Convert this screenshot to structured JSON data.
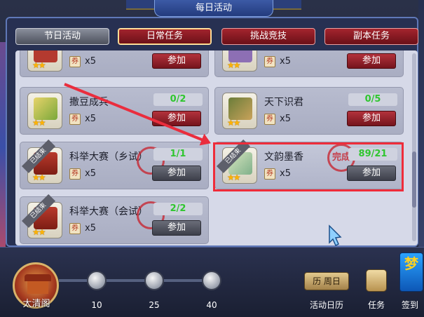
{
  "header": {
    "title": "每日活动"
  },
  "tabs": [
    {
      "label": "节日活动",
      "style": "gray"
    },
    {
      "label": "日常任务",
      "style": "red",
      "active": true
    },
    {
      "label": "挑战竞技",
      "style": "red"
    },
    {
      "label": "副本任务",
      "style": "red"
    }
  ],
  "tasks": [
    {
      "name": "",
      "count": "x5",
      "button": "参加",
      "stars": "★★"
    },
    {
      "name": "",
      "count": "x5",
      "button": "参加",
      "stars": "★★"
    },
    {
      "name": "撒豆成兵",
      "progress": "0/2",
      "count": "x5",
      "button": "参加",
      "stars": "★★"
    },
    {
      "name": "天下识君",
      "progress": "0/5",
      "count": "x5",
      "button": "参加",
      "stars": "★★"
    },
    {
      "name": "科举大赛（乡试）",
      "progress": "1/1",
      "count": "x5",
      "button": "参加",
      "stars": "★★",
      "badge": "已结束"
    },
    {
      "name": "文韵墨香",
      "progress": "89/21",
      "count": "x5",
      "button": "参加",
      "stars": "★★",
      "badge": "已结束",
      "seal": "完成"
    },
    {
      "name": "科举大赛（会试）",
      "progress": "2/2",
      "count": "x5",
      "button": "参加",
      "stars": "★★",
      "badge": "已结束"
    }
  ],
  "bottom": {
    "palace_label": "太清阁",
    "activity_progress_fraction": 0.0,
    "milestones": [
      "10",
      "25",
      "40"
    ],
    "calendar_box": "历 周日",
    "calendar_label": "活动日历",
    "task_label": "任务",
    "signin_label": "签到",
    "signin_glyph": "梦"
  },
  "colors": {
    "accent_red": "#ea2d3d",
    "progress_green": "#2fc62f",
    "star_gold": "#ffb300"
  }
}
